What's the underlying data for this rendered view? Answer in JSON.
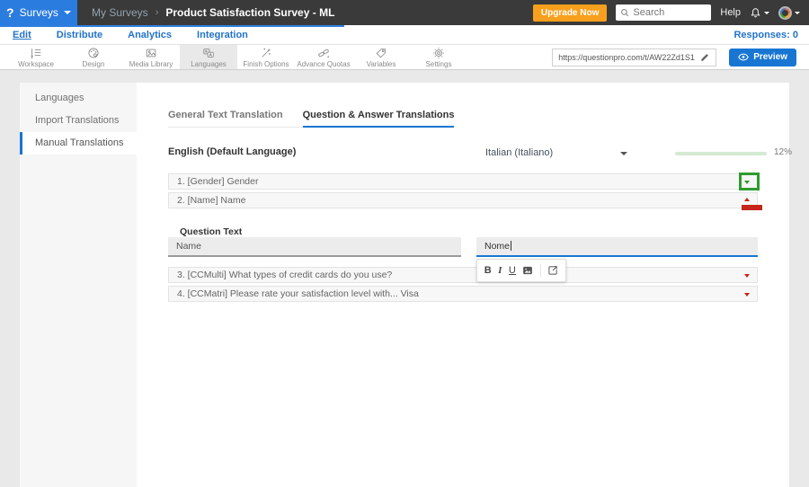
{
  "header": {
    "logo_glyph": "?",
    "product_label": "Surveys",
    "breadcrumb_parent": "My Surveys",
    "breadcrumb_sep": "›",
    "breadcrumb_current": "Product Satisfaction Survey - ML",
    "upgrade_label": "Upgrade Now",
    "search_placeholder": "Search",
    "help_label": "Help"
  },
  "nav": {
    "items": [
      {
        "label": "Edit",
        "active": true
      },
      {
        "label": "Distribute",
        "active": false
      },
      {
        "label": "Analytics",
        "active": false
      },
      {
        "label": "Integration",
        "active": false
      }
    ],
    "responses_label": "Responses: 0"
  },
  "toolbar": {
    "items": [
      {
        "label": "Workspace",
        "icon": "workspace-icon",
        "active": false
      },
      {
        "label": "Design",
        "icon": "design-palette-icon",
        "active": false
      },
      {
        "label": "Media Library",
        "icon": "media-library-icon",
        "active": false
      },
      {
        "label": "Languages",
        "icon": "languages-icon",
        "active": true
      },
      {
        "label": "Finish Options",
        "icon": "finish-options-wand-icon",
        "active": false
      },
      {
        "label": "Advance Quotas",
        "icon": "advance-quotas-chain-icon",
        "active": false
      },
      {
        "label": "Variables",
        "icon": "variables-tag-icon",
        "active": false
      },
      {
        "label": "Settings",
        "icon": "settings-gear-icon",
        "active": false
      }
    ],
    "survey_url": "https://questionpro.com/t/AW22Zd1S1",
    "preview_label": "Preview"
  },
  "sidebar": {
    "items": [
      {
        "label": "Languages",
        "active": false
      },
      {
        "label": "Import Translations",
        "active": false
      },
      {
        "label": "Manual Translations",
        "active": true
      }
    ]
  },
  "main": {
    "tabs": [
      {
        "label": "General Text Translation",
        "active": false
      },
      {
        "label": "Question & Answer Translations",
        "active": true
      }
    ],
    "source_language_label": "English (Default Language)",
    "target_language_value": "Italian (Italiano)",
    "translation_progress": "12%",
    "questions": [
      {
        "title": "1. [Gender] Gender"
      },
      {
        "title": "2. [Name] Name"
      },
      {
        "title": "3. [CCMulti] What types of credit cards do you use?"
      },
      {
        "title": "4. [CCMatri] Please rate your satisfaction level with... Visa"
      }
    ],
    "editor": {
      "section_label": "Question Text",
      "source_text": "Name",
      "target_text": "Nome"
    },
    "format_toolbar": {
      "bold_label": "B",
      "italic_label": "I",
      "underline_label": "U"
    }
  },
  "colors": {
    "accent_blue": "#1876d2",
    "header_dark": "#3a3a3a",
    "logo_blue": "#2b7cdf",
    "upgrade_orange": "#f8a01d",
    "progress_green": "#3aa13a",
    "annotation_green": "#2f9b2f",
    "annotation_red": "#c6251b"
  }
}
